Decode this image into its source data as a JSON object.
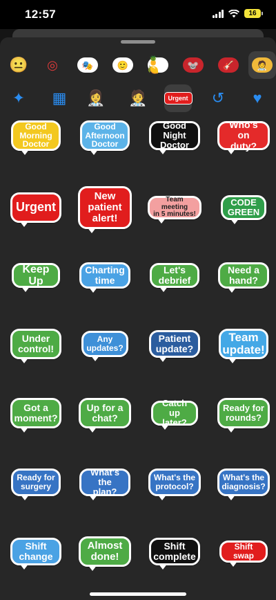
{
  "status": {
    "time": "12:57",
    "battery": "16"
  },
  "category_tabs_row1": [
    {
      "name": "smiley-emoji-tab",
      "icon": "😐",
      "style": "glyph",
      "selected": false
    },
    {
      "name": "activity-ring-tab",
      "icon": "◎",
      "style": "ring",
      "selected": false
    },
    {
      "name": "memoji-pack-1-tab",
      "icon": "🎭",
      "style": "pill",
      "selected": false
    },
    {
      "name": "memoji-pack-2-tab",
      "icon": "🙂",
      "style": "pill",
      "selected": false
    },
    {
      "name": "fruit-sticker-pack-tab",
      "icon": "🍍🍋",
      "style": "pill",
      "selected": false
    },
    {
      "name": "red-sticker-pack-tab",
      "icon": "🐭",
      "style": "pill-red",
      "selected": false
    },
    {
      "name": "guitar-sticker-pack-tab",
      "icon": "🎸",
      "style": "pill-red",
      "selected": false
    },
    {
      "name": "doctor-sticker-pack-tab",
      "icon": "🧑‍⚕️",
      "style": "pill-yellow",
      "selected": true
    }
  ],
  "category_tabs_row2": [
    {
      "name": "sparkle-emoji-tab",
      "icon": "✦",
      "style": "blue-glyph",
      "selected": false
    },
    {
      "name": "grid-apps-tab",
      "icon": "▦",
      "style": "blue-glyph",
      "selected": false
    },
    {
      "name": "nurse-sticker-tab",
      "icon": "👩‍⚕️",
      "style": "glyph",
      "selected": false
    },
    {
      "name": "surgeon-sticker-tab",
      "icon": "🧑‍⚕️",
      "style": "glyph",
      "selected": false
    },
    {
      "name": "urgent-sticker-tab",
      "icon": "Urgent",
      "style": "urgent",
      "selected": true
    },
    {
      "name": "recents-tab",
      "icon": "↺",
      "style": "blue-glyph",
      "selected": false
    },
    {
      "name": "favorites-tab",
      "icon": "♥",
      "style": "blue-glyph",
      "selected": false
    }
  ],
  "stickers": [
    {
      "text": "Good\nMorning\nDoctor",
      "bg": "#f3c81f",
      "tail": "left"
    },
    {
      "text": "Good\nAfternoon\nDoctor",
      "bg": "#5cb3e8",
      "tail": "left"
    },
    {
      "text": "Good Night\nDoctor",
      "bg": "#111111",
      "tail": "left"
    },
    {
      "text": "Who's on\nduty?",
      "bg": "#e42a2a",
      "tail": "left"
    },
    {
      "text": "Urgent",
      "bg": "#e11d1d",
      "tail": "left"
    },
    {
      "text": "New\npatient\nalert!",
      "bg": "#e11d1d",
      "tail": "left"
    },
    {
      "text": "Team meeting\nin 5 minutes!",
      "bg": "#f3a0a0",
      "tail": "left",
      "fg": "#222222"
    },
    {
      "text": "CODE\nGREEN",
      "bg": "#2f9e4a",
      "tail": "left"
    },
    {
      "text": "Keep Up",
      "bg": "#4eab45",
      "tail": "left"
    },
    {
      "text": "Charting\ntime",
      "bg": "#4aa2e4",
      "tail": "left"
    },
    {
      "text": "Let's\ndebrief",
      "bg": "#4eab45",
      "tail": "left"
    },
    {
      "text": "Need a\nhand?",
      "bg": "#4eab45",
      "tail": "left"
    },
    {
      "text": "Under\ncontrol!",
      "bg": "#4eab45",
      "tail": "left"
    },
    {
      "text": "Any\nupdates?",
      "bg": "#3e90d8",
      "tail": "left"
    },
    {
      "text": "Patient\nupdate?",
      "bg": "#2b5d9f",
      "tail": "left"
    },
    {
      "text": "Team\nupdate!",
      "bg": "#44a8e6",
      "tail": "left"
    },
    {
      "text": "Got a\nmoment?",
      "bg": "#4eab45",
      "tail": "left"
    },
    {
      "text": "Up for a\nchat?",
      "bg": "#4eab45",
      "tail": "left"
    },
    {
      "text": "Catch up\nlater?",
      "bg": "#4eab45",
      "tail": "left"
    },
    {
      "text": "Ready for\nrounds?",
      "bg": "#4eab45",
      "tail": "left"
    },
    {
      "text": "Ready for\nsurgery",
      "bg": "#3774c4",
      "tail": "left"
    },
    {
      "text": "What's the\nplan?",
      "bg": "#3774c4",
      "tail": "left"
    },
    {
      "text": "What's the\nprotocol?",
      "bg": "#3774c4",
      "tail": "left"
    },
    {
      "text": "What's the\ndiagnosis?",
      "bg": "#3774c4",
      "tail": "left"
    },
    {
      "text": "Shift\nchange",
      "bg": "#4aa2e4",
      "tail": "left"
    },
    {
      "text": "Almost\ndone!",
      "bg": "#4eab45",
      "tail": "left"
    },
    {
      "text": "Shift\ncomplete",
      "bg": "#111111",
      "tail": "left"
    },
    {
      "text": "Shift swap",
      "bg": "#e11d1d",
      "tail": "left"
    }
  ]
}
